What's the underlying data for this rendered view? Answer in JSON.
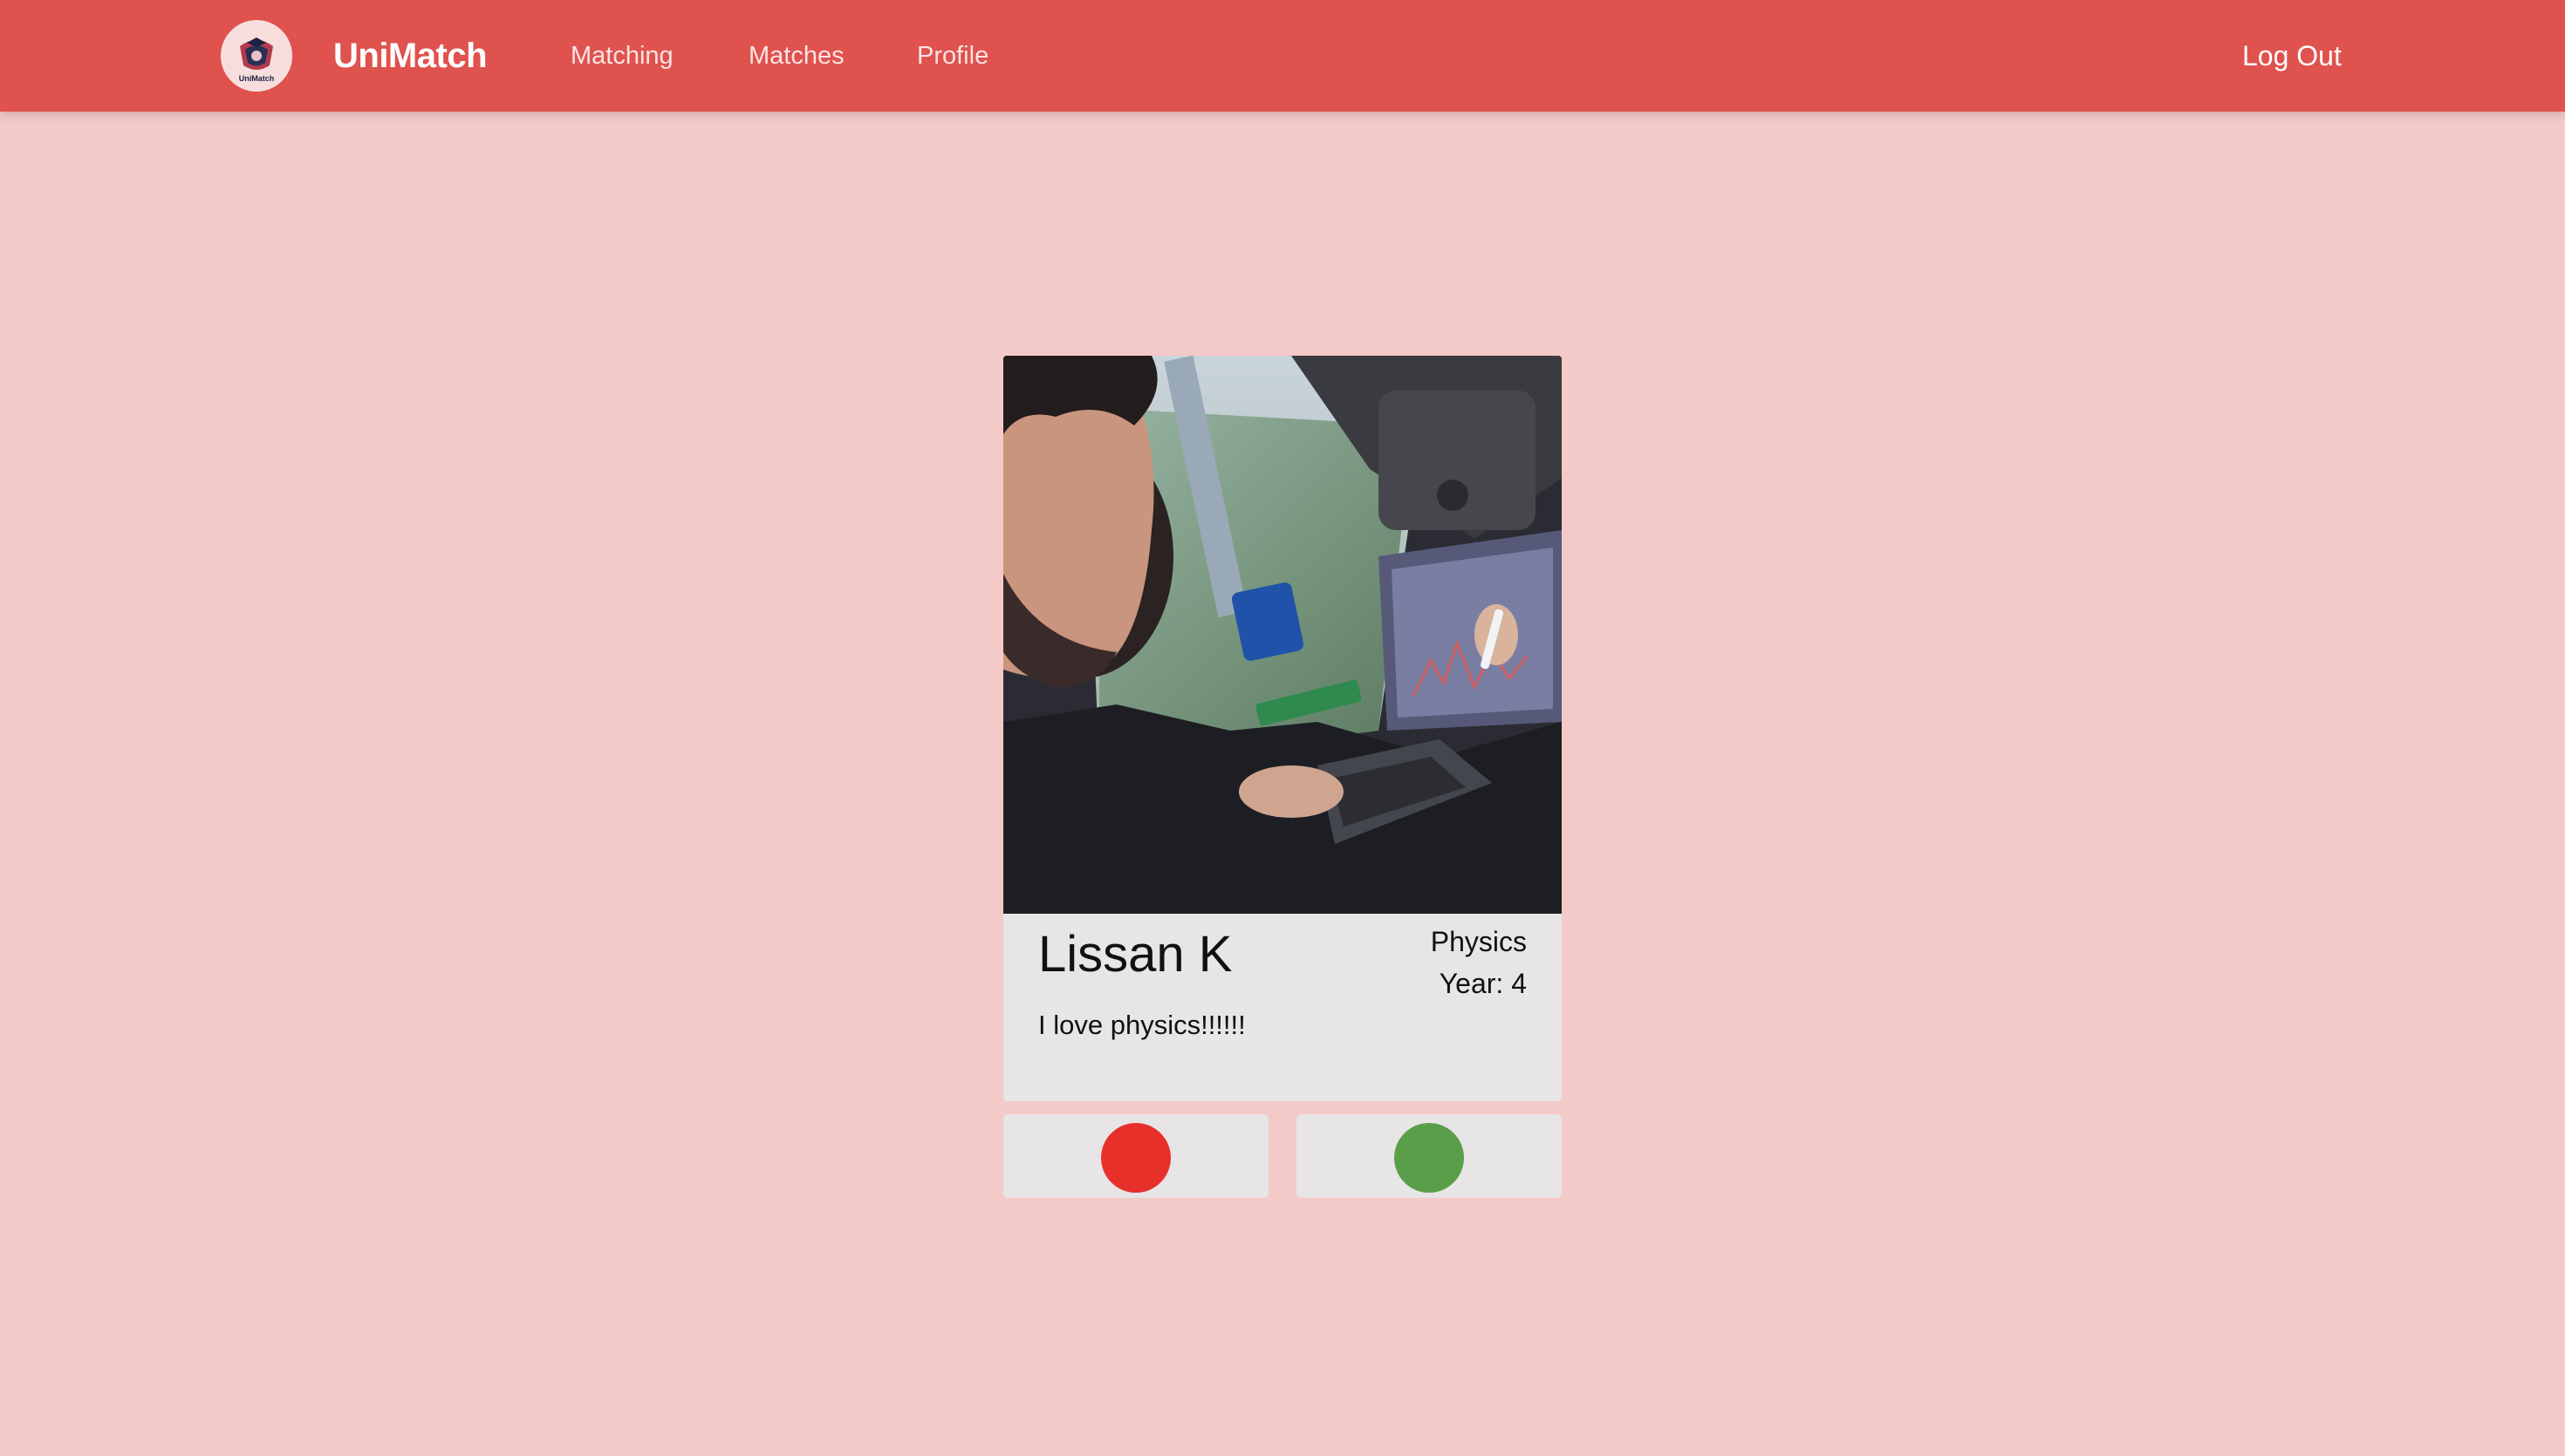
{
  "app": {
    "brand": "UniMatch",
    "logo_text": "UniMatch"
  },
  "nav": {
    "links": [
      {
        "label": "Matching"
      },
      {
        "label": "Matches"
      },
      {
        "label": "Profile"
      }
    ],
    "logout_label": "Log Out"
  },
  "profile": {
    "name": "Lissan K",
    "subject": "Physics",
    "year": "Year: 4",
    "bio": "I love physics!!!!!!",
    "photo_alt": "Profile photo"
  },
  "actions": {
    "reject_color": "#e8302a",
    "accept_color": "#5a9e4a"
  },
  "colors": {
    "navbar": "#df524e",
    "background": "#f4cac8",
    "card": "#e8e5e6"
  },
  "icons": {
    "logo": "crest-logo-icon",
    "reject": "red-dot-icon",
    "accept": "green-dot-icon"
  }
}
